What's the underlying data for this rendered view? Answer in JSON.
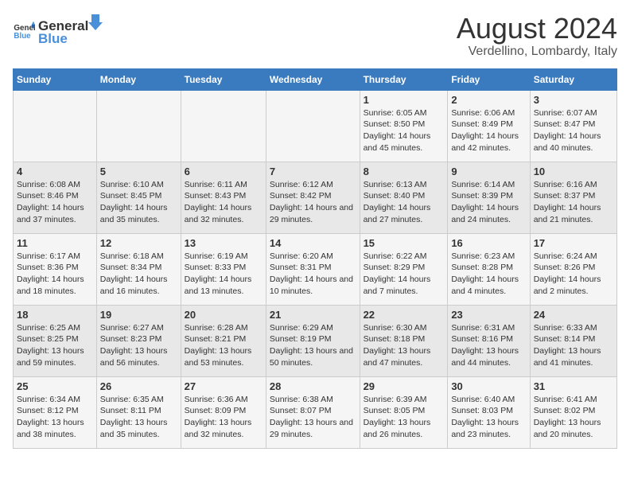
{
  "header": {
    "logo_general": "General",
    "logo_blue": "Blue",
    "main_title": "August 2024",
    "subtitle": "Verdellino, Lombardy, Italy"
  },
  "days_of_week": [
    "Sunday",
    "Monday",
    "Tuesday",
    "Wednesday",
    "Thursday",
    "Friday",
    "Saturday"
  ],
  "weeks": [
    [
      {
        "day": "",
        "info": ""
      },
      {
        "day": "",
        "info": ""
      },
      {
        "day": "",
        "info": ""
      },
      {
        "day": "",
        "info": ""
      },
      {
        "day": "1",
        "info": "Sunrise: 6:05 AM\nSunset: 8:50 PM\nDaylight: 14 hours and 45 minutes."
      },
      {
        "day": "2",
        "info": "Sunrise: 6:06 AM\nSunset: 8:49 PM\nDaylight: 14 hours and 42 minutes."
      },
      {
        "day": "3",
        "info": "Sunrise: 6:07 AM\nSunset: 8:47 PM\nDaylight: 14 hours and 40 minutes."
      }
    ],
    [
      {
        "day": "4",
        "info": "Sunrise: 6:08 AM\nSunset: 8:46 PM\nDaylight: 14 hours and 37 minutes."
      },
      {
        "day": "5",
        "info": "Sunrise: 6:10 AM\nSunset: 8:45 PM\nDaylight: 14 hours and 35 minutes."
      },
      {
        "day": "6",
        "info": "Sunrise: 6:11 AM\nSunset: 8:43 PM\nDaylight: 14 hours and 32 minutes."
      },
      {
        "day": "7",
        "info": "Sunrise: 6:12 AM\nSunset: 8:42 PM\nDaylight: 14 hours and 29 minutes."
      },
      {
        "day": "8",
        "info": "Sunrise: 6:13 AM\nSunset: 8:40 PM\nDaylight: 14 hours and 27 minutes."
      },
      {
        "day": "9",
        "info": "Sunrise: 6:14 AM\nSunset: 8:39 PM\nDaylight: 14 hours and 24 minutes."
      },
      {
        "day": "10",
        "info": "Sunrise: 6:16 AM\nSunset: 8:37 PM\nDaylight: 14 hours and 21 minutes."
      }
    ],
    [
      {
        "day": "11",
        "info": "Sunrise: 6:17 AM\nSunset: 8:36 PM\nDaylight: 14 hours and 18 minutes."
      },
      {
        "day": "12",
        "info": "Sunrise: 6:18 AM\nSunset: 8:34 PM\nDaylight: 14 hours and 16 minutes."
      },
      {
        "day": "13",
        "info": "Sunrise: 6:19 AM\nSunset: 8:33 PM\nDaylight: 14 hours and 13 minutes."
      },
      {
        "day": "14",
        "info": "Sunrise: 6:20 AM\nSunset: 8:31 PM\nDaylight: 14 hours and 10 minutes."
      },
      {
        "day": "15",
        "info": "Sunrise: 6:22 AM\nSunset: 8:29 PM\nDaylight: 14 hours and 7 minutes."
      },
      {
        "day": "16",
        "info": "Sunrise: 6:23 AM\nSunset: 8:28 PM\nDaylight: 14 hours and 4 minutes."
      },
      {
        "day": "17",
        "info": "Sunrise: 6:24 AM\nSunset: 8:26 PM\nDaylight: 14 hours and 2 minutes."
      }
    ],
    [
      {
        "day": "18",
        "info": "Sunrise: 6:25 AM\nSunset: 8:25 PM\nDaylight: 13 hours and 59 minutes."
      },
      {
        "day": "19",
        "info": "Sunrise: 6:27 AM\nSunset: 8:23 PM\nDaylight: 13 hours and 56 minutes."
      },
      {
        "day": "20",
        "info": "Sunrise: 6:28 AM\nSunset: 8:21 PM\nDaylight: 13 hours and 53 minutes."
      },
      {
        "day": "21",
        "info": "Sunrise: 6:29 AM\nSunset: 8:19 PM\nDaylight: 13 hours and 50 minutes."
      },
      {
        "day": "22",
        "info": "Sunrise: 6:30 AM\nSunset: 8:18 PM\nDaylight: 13 hours and 47 minutes."
      },
      {
        "day": "23",
        "info": "Sunrise: 6:31 AM\nSunset: 8:16 PM\nDaylight: 13 hours and 44 minutes."
      },
      {
        "day": "24",
        "info": "Sunrise: 6:33 AM\nSunset: 8:14 PM\nDaylight: 13 hours and 41 minutes."
      }
    ],
    [
      {
        "day": "25",
        "info": "Sunrise: 6:34 AM\nSunset: 8:12 PM\nDaylight: 13 hours and 38 minutes."
      },
      {
        "day": "26",
        "info": "Sunrise: 6:35 AM\nSunset: 8:11 PM\nDaylight: 13 hours and 35 minutes."
      },
      {
        "day": "27",
        "info": "Sunrise: 6:36 AM\nSunset: 8:09 PM\nDaylight: 13 hours and 32 minutes."
      },
      {
        "day": "28",
        "info": "Sunrise: 6:38 AM\nSunset: 8:07 PM\nDaylight: 13 hours and 29 minutes."
      },
      {
        "day": "29",
        "info": "Sunrise: 6:39 AM\nSunset: 8:05 PM\nDaylight: 13 hours and 26 minutes."
      },
      {
        "day": "30",
        "info": "Sunrise: 6:40 AM\nSunset: 8:03 PM\nDaylight: 13 hours and 23 minutes."
      },
      {
        "day": "31",
        "info": "Sunrise: 6:41 AM\nSunset: 8:02 PM\nDaylight: 13 hours and 20 minutes."
      }
    ]
  ]
}
